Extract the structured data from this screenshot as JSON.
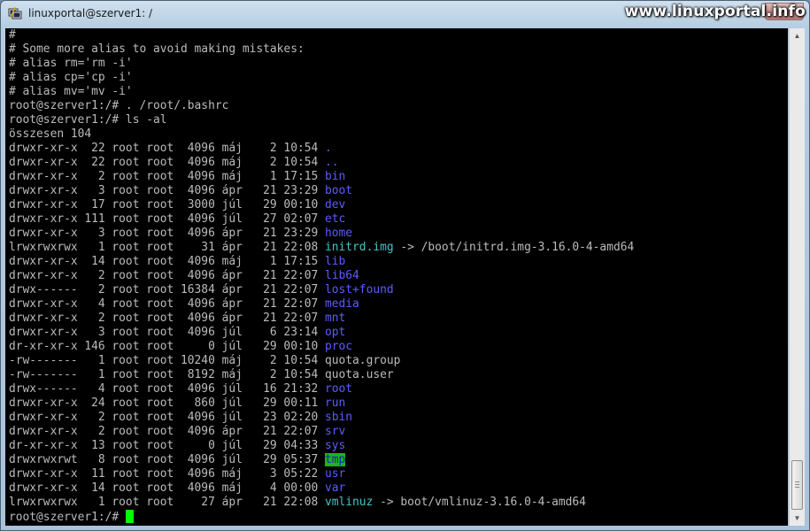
{
  "window": {
    "title": "linuxportal@szerver1: /",
    "watermark": "www.linuxportal.info",
    "icon": "putty-terminal-icon"
  },
  "terminal": {
    "lines": [
      {
        "text": "#"
      },
      {
        "text": "# Some more alias to avoid making mistakes:"
      },
      {
        "text": "# alias rm='rm -i'"
      },
      {
        "text": "# alias cp='cp -i'"
      },
      {
        "text": "# alias mv='mv -i'"
      },
      {
        "text": "root@szerver1:/# . /root/.bashrc"
      },
      {
        "text": "root@szerver1:/# ls -al"
      },
      {
        "text": "összesen 104"
      },
      {
        "prefix": "drwxr-xr-x  22 root root  4096 máj    2 10:54 ",
        "name": ".",
        "type": "dir"
      },
      {
        "prefix": "drwxr-xr-x  22 root root  4096 máj    2 10:54 ",
        "name": "..",
        "type": "dir"
      },
      {
        "prefix": "drwxr-xr-x   2 root root  4096 máj    1 17:15 ",
        "name": "bin",
        "type": "dir"
      },
      {
        "prefix": "drwxr-xr-x   3 root root  4096 ápr   21 23:29 ",
        "name": "boot",
        "type": "dir"
      },
      {
        "prefix": "drwxr-xr-x  17 root root  3000 júl   29 00:10 ",
        "name": "dev",
        "type": "dir"
      },
      {
        "prefix": "drwxr-xr-x 111 root root  4096 júl   27 02:07 ",
        "name": "etc",
        "type": "dir"
      },
      {
        "prefix": "drwxr-xr-x   3 root root  4096 ápr   21 23:29 ",
        "name": "home",
        "type": "dir"
      },
      {
        "prefix": "lrwxrwxrwx   1 root root    31 ápr   21 22:08 ",
        "name": "initrd.img",
        "type": "link",
        "suffix": " -> /boot/initrd.img-3.16.0-4-amd64"
      },
      {
        "prefix": "drwxr-xr-x  14 root root  4096 máj    1 17:15 ",
        "name": "lib",
        "type": "dir"
      },
      {
        "prefix": "drwxr-xr-x   2 root root  4096 ápr   21 22:07 ",
        "name": "lib64",
        "type": "dir"
      },
      {
        "prefix": "drwx------   2 root root 16384 ápr   21 22:07 ",
        "name": "lost+found",
        "type": "dir"
      },
      {
        "prefix": "drwxr-xr-x   4 root root  4096 ápr   21 22:07 ",
        "name": "media",
        "type": "dir"
      },
      {
        "prefix": "drwxr-xr-x   2 root root  4096 ápr   21 22:07 ",
        "name": "mnt",
        "type": "dir"
      },
      {
        "prefix": "drwxr-xr-x   3 root root  4096 júl    6 23:14 ",
        "name": "opt",
        "type": "dir"
      },
      {
        "prefix": "dr-xr-xr-x 146 root root     0 júl   29 00:10 ",
        "name": "proc",
        "type": "dir"
      },
      {
        "prefix": "-rw-------   1 root root 10240 máj    2 10:54 ",
        "name": "quota.group",
        "type": "file"
      },
      {
        "prefix": "-rw-------   1 root root  8192 máj    2 10:54 ",
        "name": "quota.user",
        "type": "file"
      },
      {
        "prefix": "drwx------   4 root root  4096 júl   16 21:32 ",
        "name": "root",
        "type": "dir"
      },
      {
        "prefix": "drwxr-xr-x  24 root root   860 júl   29 00:11 ",
        "name": "run",
        "type": "dir"
      },
      {
        "prefix": "drwxr-xr-x   2 root root  4096 júl   23 02:20 ",
        "name": "sbin",
        "type": "dir"
      },
      {
        "prefix": "drwxr-xr-x   2 root root  4096 ápr   21 22:07 ",
        "name": "srv",
        "type": "dir"
      },
      {
        "prefix": "dr-xr-xr-x  13 root root     0 júl   29 04:33 ",
        "name": "sys",
        "type": "dir"
      },
      {
        "prefix": "drwxrwxrwt   8 root root  4096 júl   29 05:37 ",
        "name": "tmp",
        "type": "sticky"
      },
      {
        "prefix": "drwxr-xr-x  11 root root  4096 máj    3 05:22 ",
        "name": "usr",
        "type": "dir"
      },
      {
        "prefix": "drwxr-xr-x  14 root root  4096 máj    4 00:00 ",
        "name": "var",
        "type": "dir"
      },
      {
        "prefix": "lrwxrwxrwx   1 root root    27 ápr   21 22:08 ",
        "name": "vmlinuz",
        "type": "link",
        "suffix": " -> boot/vmlinuz-3.16.0-4-amd64"
      }
    ],
    "prompt": "root@szerver1:/# "
  },
  "colors": {
    "background": "#000000",
    "foreground": "#bbbbbb",
    "directory": "#5c5cff",
    "symlink": "#3fc6c6",
    "sticky_fg": "#1e1ec8",
    "sticky_bg": "#17b817",
    "cursor": "#00ff00"
  }
}
